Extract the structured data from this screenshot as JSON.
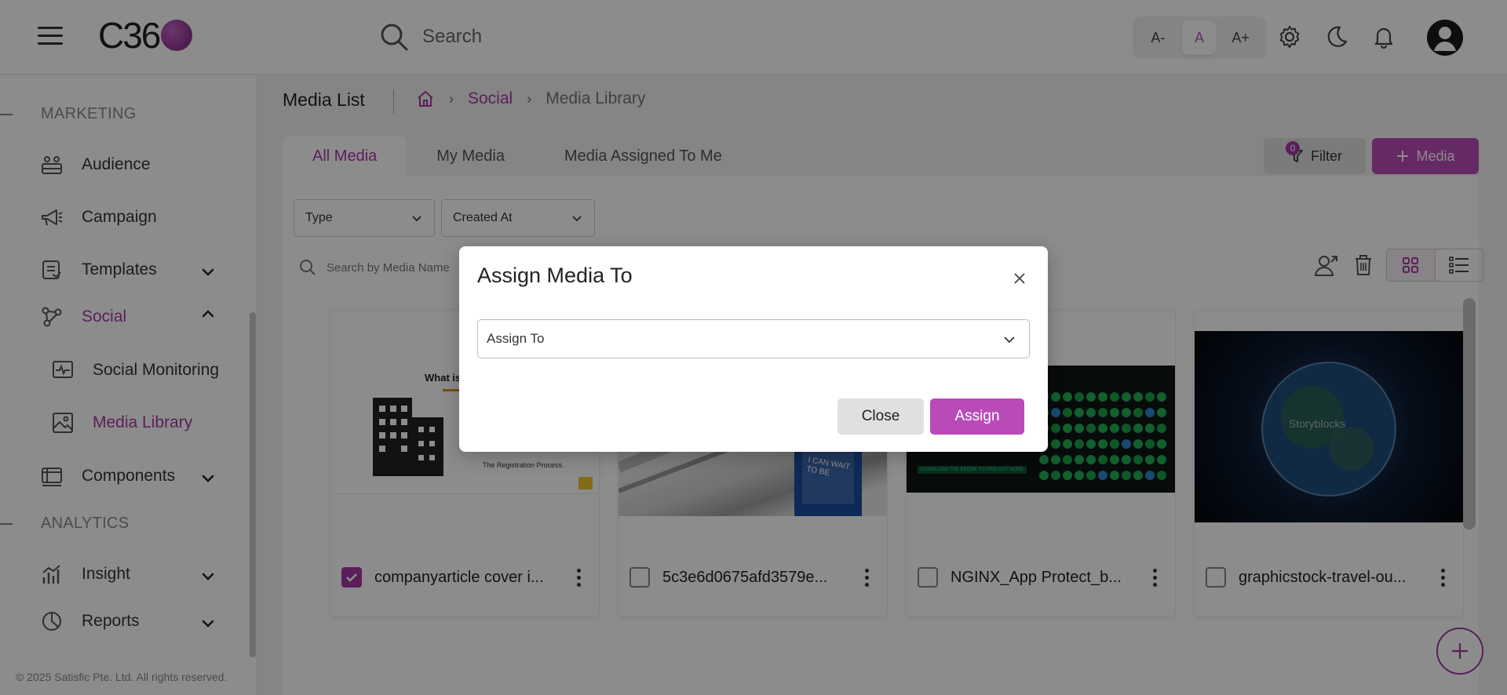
{
  "header": {
    "search_placeholder": "Search",
    "font_sizes": [
      "A-",
      "A",
      "A+"
    ],
    "active_font": "A",
    "icons": [
      "hamburger-icon",
      "search-icon",
      "gear-icon",
      "moon-icon",
      "bell-icon",
      "user-avatar-icon"
    ]
  },
  "logo": {
    "text": "C36"
  },
  "sidebar": {
    "sections": [
      {
        "label": "MARKETING"
      },
      {
        "label": "ANALYTICS"
      }
    ],
    "items": {
      "audience": "Audience",
      "campaign": "Campaign",
      "templates": "Templates",
      "social": "Social",
      "social_monitoring": "Social Monitoring",
      "media_library": "Media Library",
      "components": "Components",
      "insight": "Insight",
      "reports": "Reports"
    },
    "footer": "© 2025 Satisfic Pte. Ltd. All rights reserved."
  },
  "page": {
    "title": "Media List",
    "breadcrumb": {
      "social": "Social",
      "current": "Media Library"
    }
  },
  "tabs": [
    "All Media",
    "My Media",
    "Media Assigned To Me"
  ],
  "actions": {
    "filter": "Filter",
    "filter_count": "0",
    "add_media": "Media"
  },
  "filters": {
    "type": "Type",
    "created_at": "Created At",
    "search_placeholder": "Search by Media Name"
  },
  "cards": [
    {
      "name": "companyarticle cover i...",
      "checked": true,
      "thumb_text": "What is a Co",
      "thumb_subtext": "The Registration Process."
    },
    {
      "name": "5c3e6d0675afd3579e...",
      "checked": false,
      "thumb_text": "I CAN WAIT TO BE"
    },
    {
      "name": "NGINX_App Protect_b...",
      "checked": false,
      "thumb_text": "DOWNLOAD THE EBOOK TO FIND OUT MORE"
    },
    {
      "name": "graphicstock-travel-ou...",
      "checked": false,
      "thumb_text": "Storyblocks"
    }
  ],
  "modal": {
    "title": "Assign Media To",
    "select_label": "Assign To",
    "close_label": "Close",
    "assign_label": "Assign"
  },
  "colors": {
    "accent": "#b94bb9",
    "accent_dark": "#a53aa5",
    "overlay": "rgba(0,0,0,0.45)"
  }
}
